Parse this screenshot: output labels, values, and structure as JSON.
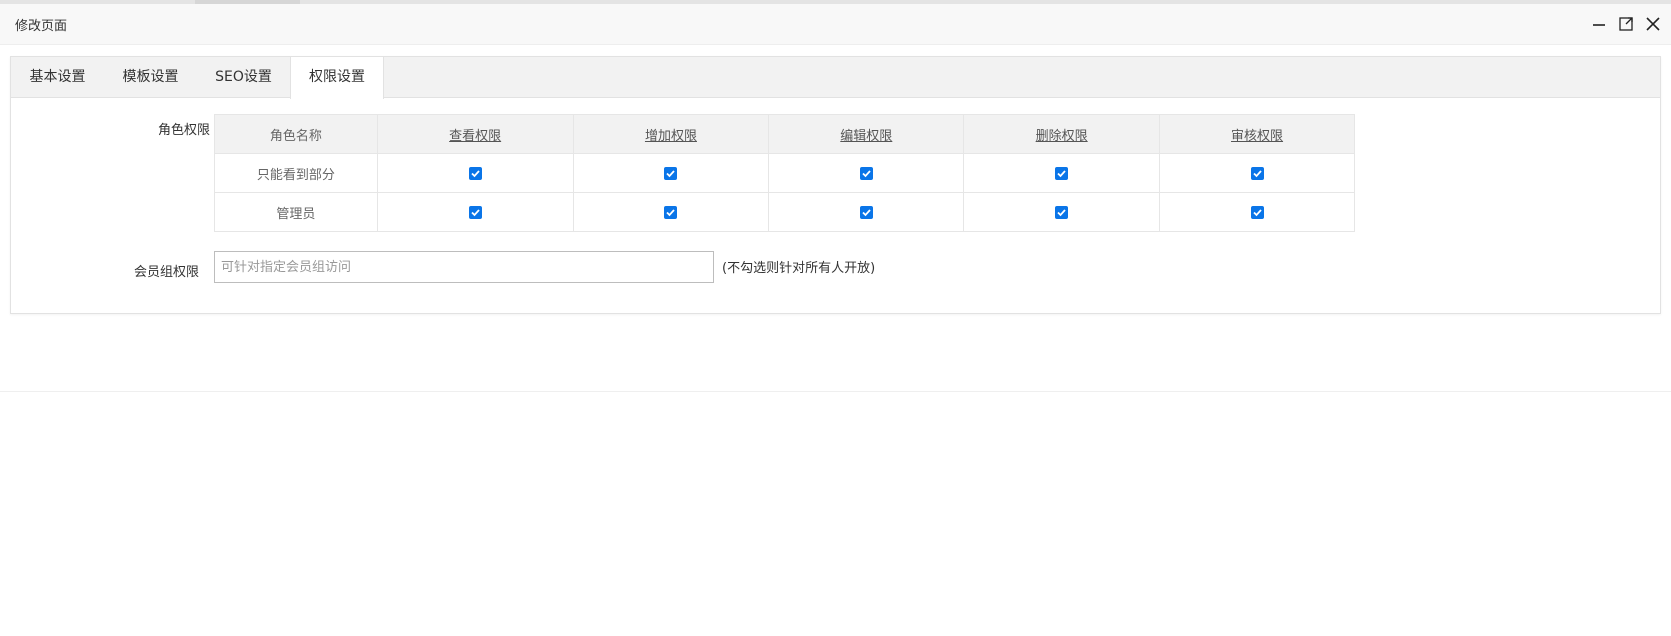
{
  "window": {
    "title": "修改页面",
    "controls": [
      "minimize-icon",
      "maximize-icon",
      "close-icon"
    ]
  },
  "tabs": [
    {
      "label": "基本设置",
      "active": false
    },
    {
      "label": "模板设置",
      "active": false
    },
    {
      "label": "SEO设置",
      "active": false
    },
    {
      "label": "权限设置",
      "active": true
    }
  ],
  "role_permissions": {
    "label": "角色权限",
    "columns": [
      "角色名称",
      "查看权限",
      "增加权限",
      "编辑权限",
      "删除权限",
      "审核权限"
    ],
    "rows": [
      {
        "name": "只能看到部分",
        "checked": [
          true,
          true,
          true,
          true,
          true
        ]
      },
      {
        "name": "管理员",
        "checked": [
          true,
          true,
          true,
          true,
          true
        ]
      }
    ]
  },
  "member_group": {
    "label": "会员组权限",
    "placeholder": "可针对指定会员组访问",
    "value": "",
    "hint": "(不勾选则针对所有人开放)"
  },
  "colors": {
    "checkbox": "#0a75e8",
    "tabbar_bg": "#f2f2f2",
    "titlebar_bg": "#f8f8f8"
  }
}
